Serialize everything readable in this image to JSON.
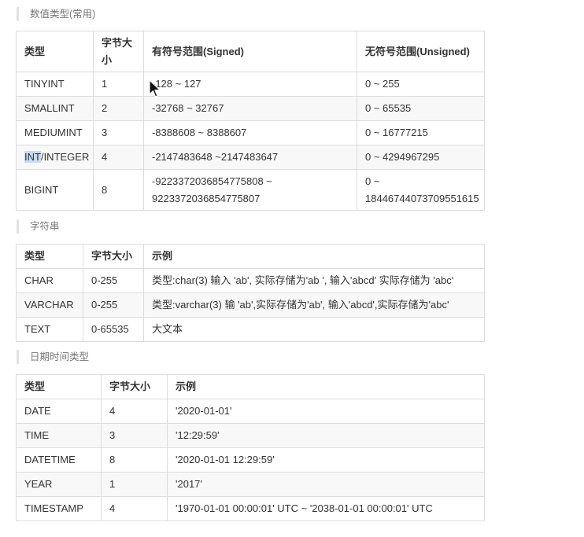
{
  "sections": {
    "numeric": {
      "title": "数值类型(常用)",
      "headers": [
        "类型",
        "字节大小",
        "有符号范围(Signed)",
        "无符号范围(Unsigned)"
      ],
      "rows": [
        [
          "TINYINT",
          "1",
          "-128 ~ 127",
          "0 ~ 255"
        ],
        [
          "SMALLINT",
          "2",
          "-32768 ~ 32767",
          "0 ~ 65535"
        ],
        [
          "MEDIUMINT",
          "3",
          "-8388608 ~ 8388607",
          "0 ~ 16777215"
        ],
        [
          "INT/INTEGER",
          "4",
          "-2147483648 ~2147483647",
          "0 ~ 4294967295"
        ],
        [
          "BIGINT",
          "8",
          "-9223372036854775808 ~ 9223372036854775807",
          "0 ~ 18446744073709551615"
        ]
      ],
      "int_highlight": "INT",
      "int_rest": "/INTEGER"
    },
    "string": {
      "title": "字符串",
      "headers": [
        "类型",
        "字节大小",
        "示例"
      ],
      "rows": [
        [
          "CHAR",
          "0-255",
          "类型:char(3) 输入 'ab', 实际存储为'ab ', 输入'abcd' 实际存储为 'abc'"
        ],
        [
          "VARCHAR",
          "0-255",
          "类型:varchar(3) 输 'ab',实际存储为'ab', 输入'abcd',实际存储为'abc'"
        ],
        [
          "TEXT",
          "0-65535",
          "大文本"
        ]
      ]
    },
    "datetime": {
      "title": "日期时间类型",
      "headers": [
        "类型",
        "字节大小",
        "示例"
      ],
      "rows": [
        [
          "DATE",
          "4",
          "'2020-01-01'"
        ],
        [
          "TIME",
          "3",
          "'12:29:59'"
        ],
        [
          "DATETIME",
          "8",
          "'2020-01-01 12:29:59'"
        ],
        [
          "YEAR",
          "1",
          "'2017'"
        ],
        [
          "TIMESTAMP",
          "4",
          "'1970-01-01 00:00:01' UTC ~ '2038-01-01 00:00:01' UTC"
        ]
      ]
    }
  },
  "cursor": {
    "icon": "mouse-pointer-icon"
  }
}
